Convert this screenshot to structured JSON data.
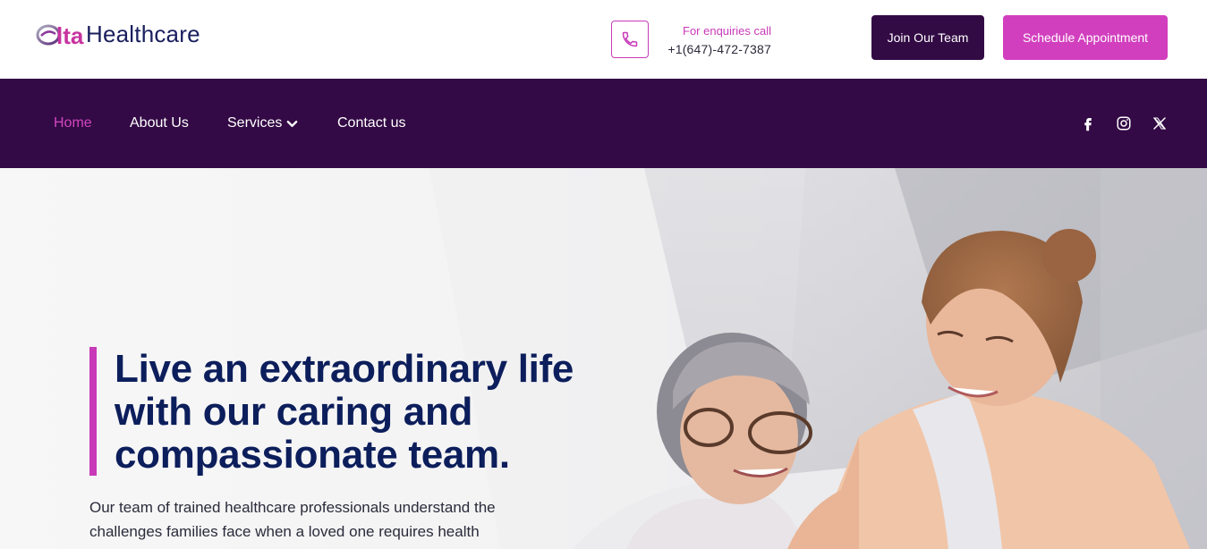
{
  "brand": {
    "logo_text": "Healthcare",
    "logo_name": "Elta Healthcare logo"
  },
  "header": {
    "enquiry_label": "For enquiries call",
    "phone_number": "+1(647)-472-7387",
    "join_button": "Join Our Team",
    "schedule_button": "Schedule Appointment"
  },
  "nav": {
    "items": [
      {
        "label": "Home",
        "active": true
      },
      {
        "label": "About Us",
        "active": false
      },
      {
        "label": "Services",
        "active": false,
        "has_dropdown": true
      },
      {
        "label": "Contact us",
        "active": false
      }
    ],
    "social": [
      "facebook-icon",
      "instagram-icon",
      "x-twitter-icon"
    ]
  },
  "hero": {
    "title": "Live an extraordinary life with our caring and compassionate team.",
    "body": "Our team of trained healthcare professionals understand the challenges families face when a loved one requires health care services. We provide peace of"
  },
  "colors": {
    "brand_purple": "#330a45",
    "accent_magenta": "#d23fbe",
    "title_navy": "#0c1e5b"
  }
}
